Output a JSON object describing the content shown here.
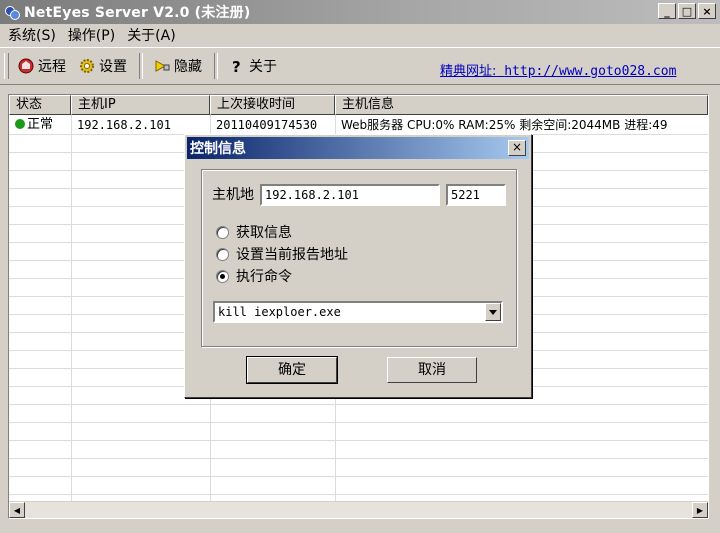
{
  "window": {
    "title": "NetEyes Server V2.0 (未注册)",
    "controls": {
      "minimize": "_",
      "maximize": "□",
      "close": "×"
    }
  },
  "menu": [
    {
      "label": "系统(S)"
    },
    {
      "label": "操作(P)"
    },
    {
      "label": "关于(A)"
    }
  ],
  "toolbar": {
    "remote": "远程",
    "settings": "设置",
    "hide": "隐藏",
    "about": "关于",
    "link_label": "精典网址:",
    "link_url": "http://www.goto028.com"
  },
  "table": {
    "columns": [
      "状态",
      "主机IP",
      "上次接收时间",
      "主机信息"
    ],
    "rows": [
      {
        "status": "正常",
        "status_color": "#1a9a1a",
        "ip": "192.168.2.101",
        "time": "20110409174530",
        "info": "Web服务器 CPU:0% RAM:25% 剩余空间:2044MB 进程:49"
      }
    ]
  },
  "dialog": {
    "title": "控制信息",
    "close": "×",
    "host_label": "主机地",
    "host_value": "192.168.2.101",
    "port_value": "5221",
    "options": [
      {
        "label": "获取信息",
        "selected": false
      },
      {
        "label": "设置当前报告地址",
        "selected": false
      },
      {
        "label": "执行命令",
        "selected": true
      }
    ],
    "command_value": "kill iexploer.exe",
    "ok_label": "确定",
    "cancel_label": "取消"
  },
  "colors": {
    "title_active": "#0a246a",
    "title_inactive": "#7b7b7b",
    "face": "#d4d0c8",
    "link": "#0000c0"
  }
}
